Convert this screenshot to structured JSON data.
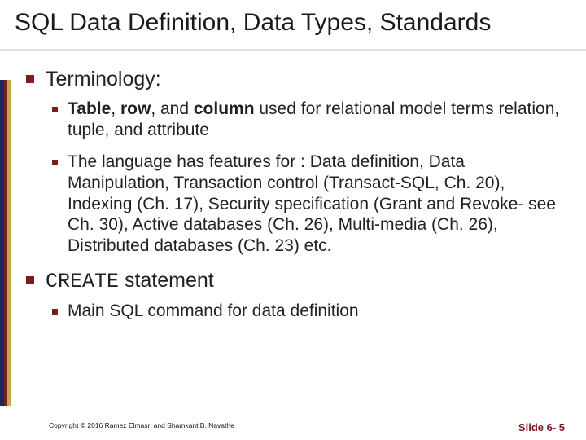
{
  "title": "SQL Data Definition, Data Types, Standards",
  "bullets": {
    "terminology_label": "Terminology:",
    "sub1_html": "<b>Table</b>, <b>row</b>, and <b>column</b> used for relational model terms relation, tuple, and attribute",
    "sub2": "The language has features for : Data definition, Data Manipulation, Transaction control (Transact-SQL, Ch. 20), Indexing (Ch. 17), Security specification (Grant and Revoke- see Ch. 30), Active databases (Ch. 26), Multi-media (Ch. 26), Distributed databases (Ch. 23) etc.",
    "create_code": "CREATE",
    "create_rest": " statement",
    "sub3": "Main SQL command for data definition"
  },
  "footer": {
    "copyright": "Copyright © 2016 Ramez Elmasri and Shamkant B. Navathe",
    "page": "Slide 6- 5"
  }
}
